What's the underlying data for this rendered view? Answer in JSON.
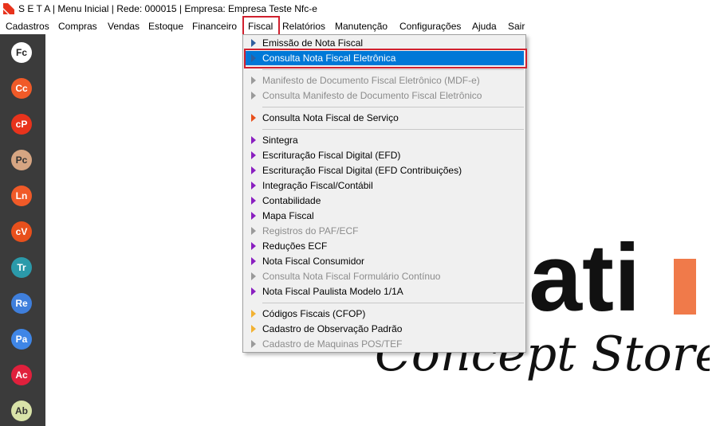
{
  "window": {
    "title": "S E T A | Menu Inicial | Rede: 000015 | Empresa: Empresa Teste Nfc-e"
  },
  "menubar": [
    "Cadastros",
    "Compras",
    "Vendas",
    "Estoque",
    "Financeiro",
    "Fiscal",
    "Relatórios",
    "Manutenção",
    "Configurações",
    "Ajuda",
    "Sair"
  ],
  "sidebar": [
    {
      "label": "Fc",
      "bg": "#ffffff",
      "fg": "#222222"
    },
    {
      "label": "Cc",
      "bg": "#f05a28",
      "fg": "#ffffff"
    },
    {
      "label": "cP",
      "bg": "#e8331c",
      "fg": "#ffffff"
    },
    {
      "label": "Pc",
      "bg": "#d6a582",
      "fg": "#333333"
    },
    {
      "label": "Ln",
      "bg": "#f05a28",
      "fg": "#ffffff"
    },
    {
      "label": "cV",
      "bg": "#e8501c",
      "fg": "#ffffff"
    },
    {
      "label": "Tr",
      "bg": "#2b9aaa",
      "fg": "#ffffff"
    },
    {
      "label": "Re",
      "bg": "#3f7fdc",
      "fg": "#ffffff"
    },
    {
      "label": "Pa",
      "bg": "#3f86e6",
      "fg": "#ffffff"
    },
    {
      "label": "Ac",
      "bg": "#e0203c",
      "fg": "#ffffff"
    },
    {
      "label": "Ab",
      "bg": "#d9e3a8",
      "fg": "#333333"
    }
  ],
  "fiscal_menu": {
    "groups": [
      [
        {
          "label": "Emissão de Nota Fiscal",
          "enabled": true,
          "arrow": "#2e5f9e"
        },
        {
          "label": "Consulta Nota Fiscal Eletrônica",
          "enabled": true,
          "arrow": "#2e5f9e",
          "selected": true
        }
      ],
      [
        {
          "label": "Manifesto de Documento Fiscal Eletrônico (MDF-e)",
          "enabled": false,
          "arrow": "#9a9a9a"
        },
        {
          "label": "Consulta Manifesto de Documento Fiscal Eletrônico",
          "enabled": false,
          "arrow": "#9a9a9a"
        }
      ],
      [
        {
          "label": "Consulta Nota Fiscal de Serviço",
          "enabled": true,
          "arrow": "#e8501c"
        }
      ],
      [
        {
          "label": "Sintegra",
          "enabled": true,
          "arrow": "#8a1fc0"
        },
        {
          "label": "Escrituração Fiscal Digital (EFD)",
          "enabled": true,
          "arrow": "#8a1fc0"
        },
        {
          "label": "Escrituração Fiscal Digital (EFD Contribuições)",
          "enabled": true,
          "arrow": "#8a1fc0"
        },
        {
          "label": "Integração Fiscal/Contábil",
          "enabled": true,
          "arrow": "#8a1fc0"
        },
        {
          "label": "Contabilidade",
          "enabled": true,
          "arrow": "#8a1fc0"
        },
        {
          "label": "Mapa Fiscal",
          "enabled": true,
          "arrow": "#8a1fc0"
        },
        {
          "label": "Registros do PAF/ECF",
          "enabled": false,
          "arrow": "#9a9a9a"
        },
        {
          "label": "Reduções ECF",
          "enabled": true,
          "arrow": "#8a1fc0"
        },
        {
          "label": "Nota Fiscal Consumidor",
          "enabled": true,
          "arrow": "#8a1fc0"
        },
        {
          "label": "Consulta Nota Fiscal Formulário Contínuo",
          "enabled": false,
          "arrow": "#9a9a9a"
        },
        {
          "label": "Nota Fiscal Paulista Modelo 1/1A",
          "enabled": true,
          "arrow": "#8a1fc0"
        }
      ],
      [
        {
          "label": "Códigos Fiscais (CFOP)",
          "enabled": true,
          "arrow": "#f2b233"
        },
        {
          "label": "Cadastro de Observação Padrão",
          "enabled": true,
          "arrow": "#f2b233"
        },
        {
          "label": "Cadastro de Maquinas POS/TEF",
          "enabled": false,
          "arrow": "#9a9a9a"
        }
      ]
    ]
  },
  "brand": {
    "partial_word": "bati",
    "tagline": "Concept Store",
    "accent": "#f07a4a"
  }
}
